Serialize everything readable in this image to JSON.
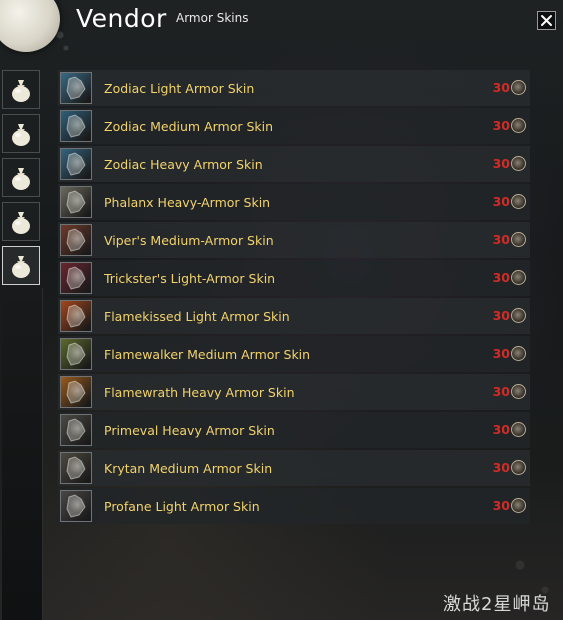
{
  "window": {
    "title": "Vendor",
    "subtitle": "Armor Skins",
    "close_symbol": "✕"
  },
  "sidebar": {
    "tabs": [
      {
        "icon": "money-bag-icon",
        "active": false
      },
      {
        "icon": "money-bag-icon",
        "active": false
      },
      {
        "icon": "money-bag-icon",
        "active": false
      },
      {
        "icon": "money-bag-icon",
        "active": false
      },
      {
        "icon": "money-bag-icon",
        "active": true
      }
    ]
  },
  "items": [
    {
      "name": "Zodiac Light Armor Skin",
      "price": "30",
      "icon_color": "#3a6a86"
    },
    {
      "name": "Zodiac Medium Armor Skin",
      "price": "30",
      "icon_color": "#2f5f7a"
    },
    {
      "name": "Zodiac Heavy Armor Skin",
      "price": "30",
      "icon_color": "#356480"
    },
    {
      "name": "Phalanx Heavy-Armor Skin",
      "price": "30",
      "icon_color": "#6b6a5d"
    },
    {
      "name": "Viper's Medium-Armor Skin",
      "price": "30",
      "icon_color": "#6e3a2c"
    },
    {
      "name": "Trickster's Light-Armor Skin",
      "price": "30",
      "icon_color": "#6a2530"
    },
    {
      "name": "Flamekissed Light Armor Skin",
      "price": "30",
      "icon_color": "#a5461c"
    },
    {
      "name": "Flamewalker Medium Armor Skin",
      "price": "30",
      "icon_color": "#5c6a2e"
    },
    {
      "name": "Flamewrath Heavy Armor Skin",
      "price": "30",
      "icon_color": "#9a5a1c"
    },
    {
      "name": "Primeval Heavy Armor Skin",
      "price": "30",
      "icon_color": "#4c4a45"
    },
    {
      "name": "Krytan Medium Armor Skin",
      "price": "30",
      "icon_color": "#4e4a42"
    },
    {
      "name": "Profane Light Armor Skin",
      "price": "30",
      "icon_color": "#4a4646"
    }
  ],
  "currency": {
    "icon": "karma-coin-icon",
    "value_color": "#d22b26"
  },
  "watermark": "激战2星岬岛"
}
